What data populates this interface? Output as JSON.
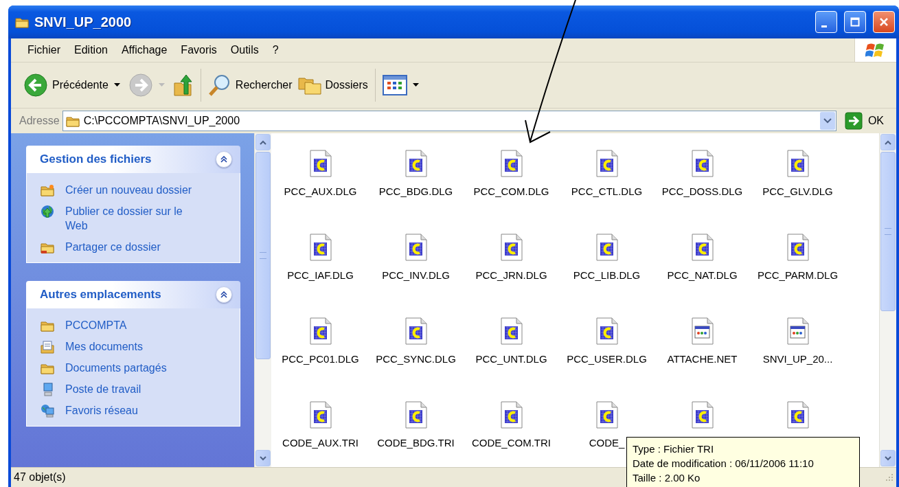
{
  "window": {
    "title": "SNVI_UP_2000"
  },
  "menu": [
    {
      "label": "Fichier"
    },
    {
      "label": "Edition"
    },
    {
      "label": "Affichage"
    },
    {
      "label": "Favoris"
    },
    {
      "label": "Outils"
    },
    {
      "label": "?"
    }
  ],
  "toolbar": [
    {
      "kind": "back",
      "label": "Précédente",
      "disabled": false
    },
    {
      "kind": "forward",
      "disabled": true
    },
    {
      "kind": "up"
    },
    {
      "kind": "search",
      "label": "Rechercher"
    },
    {
      "kind": "folders",
      "label": "Dossiers"
    },
    {
      "kind": "views"
    }
  ],
  "address": {
    "label": "Adresse",
    "value": "C:\\PCCOMPTA\\SNVI_UP_2000",
    "go": "OK"
  },
  "sidebar": [
    {
      "title": "Gestion des fichiers",
      "expanded": true,
      "items": [
        {
          "kind": "new-folder",
          "label": "Créer un nouveau dossier"
        },
        {
          "kind": "publish",
          "label": "Publier ce dossier sur le Web"
        },
        {
          "kind": "share",
          "label": "Partager ce dossier"
        }
      ]
    },
    {
      "title": "Autres emplacements",
      "expanded": true,
      "items": [
        {
          "kind": "folder",
          "label": "PCCOMPTA"
        },
        {
          "kind": "documents",
          "label": "Mes documents"
        },
        {
          "kind": "folder",
          "label": "Documents partagés"
        },
        {
          "kind": "computer",
          "label": "Poste de travail"
        },
        {
          "kind": "network",
          "label": "Favoris réseau"
        }
      ]
    }
  ],
  "files": [
    {
      "kind": "dlg",
      "name": "PCC_AUX.DLG"
    },
    {
      "kind": "dlg",
      "name": "PCC_BDG.DLG"
    },
    {
      "kind": "dlg",
      "name": "PCC_COM.DLG"
    },
    {
      "kind": "dlg",
      "name": "PCC_CTL.DLG"
    },
    {
      "kind": "dlg",
      "name": "PCC_DOSS.DLG"
    },
    {
      "kind": "dlg",
      "name": "PCC_GLV.DLG"
    },
    {
      "kind": "dlg",
      "name": "PCC_IAF.DLG"
    },
    {
      "kind": "dlg",
      "name": "PCC_INV.DLG"
    },
    {
      "kind": "dlg",
      "name": "PCC_JRN.DLG"
    },
    {
      "kind": "dlg",
      "name": "PCC_LIB.DLG"
    },
    {
      "kind": "dlg",
      "name": "PCC_NAT.DLG"
    },
    {
      "kind": "dlg",
      "name": "PCC_PARM.DLG"
    },
    {
      "kind": "dlg",
      "name": "PCC_PC01.DLG"
    },
    {
      "kind": "dlg",
      "name": "PCC_SYNC.DLG"
    },
    {
      "kind": "dlg",
      "name": "PCC_UNT.DLG"
    },
    {
      "kind": "dlg",
      "name": "PCC_USER.DLG"
    },
    {
      "kind": "window",
      "name": "ATTACHE.NET"
    },
    {
      "kind": "window",
      "name": "SNVI_UP_20..."
    },
    {
      "kind": "dlg",
      "name": "CODE_AUX.TRI"
    },
    {
      "kind": "dlg",
      "name": "CODE_BDG.TRI"
    },
    {
      "kind": "dlg",
      "name": "CODE_COM.TRI"
    },
    {
      "kind": "dlg",
      "name": "CODE_"
    },
    {
      "kind": "dlg"
    },
    {
      "kind": "dlg"
    }
  ],
  "tooltip": {
    "lines": [
      "Type : Fichier TRI",
      "Date de modification : 06/11/2006 11:10",
      "Taille  : 2.00 Ko"
    ]
  },
  "status_bar": {
    "text": "47 objet(s)"
  }
}
